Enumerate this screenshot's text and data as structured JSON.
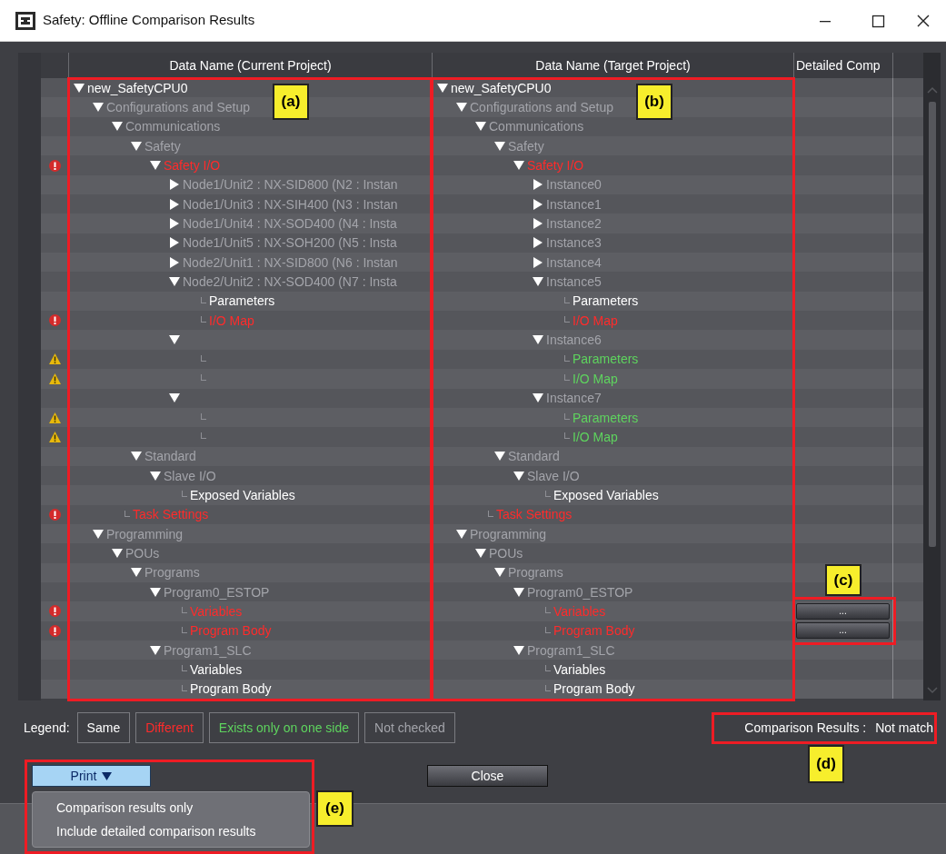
{
  "window": {
    "title": "Safety: Offline Comparison Results"
  },
  "table": {
    "columns": [
      "Data Name (Current Project)",
      "Data Name (Target Project)",
      "Detailed Comp"
    ],
    "current_tree": [
      {
        "label": "new_SafetyCPU0",
        "kind": "branch",
        "expanded": true,
        "color": "#ffffff",
        "children": [
          {
            "label": "Configurations and Setup",
            "kind": "branch",
            "expanded": true,
            "color": "#a3a4aa",
            "children": [
              {
                "label": "Communications",
                "kind": "branch",
                "expanded": true,
                "color": "#a3a4aa",
                "children": [
                  {
                    "label": "Safety",
                    "kind": "branch",
                    "expanded": true,
                    "color": "#a3a4aa",
                    "children": [
                      {
                        "label": "Safety I/O",
                        "kind": "branch",
                        "expanded": true,
                        "color": "#ff2b2b",
                        "error": true,
                        "children": [
                          {
                            "label": "Node1/Unit2 : NX-SID800 (N2 : Instan",
                            "kind": "branch",
                            "expanded": false,
                            "color": "#a3a4aa"
                          },
                          {
                            "label": "Node1/Unit3 : NX-SIH400 (N3 : Instan",
                            "kind": "branch",
                            "expanded": false,
                            "color": "#a3a4aa"
                          },
                          {
                            "label": "Node1/Unit4 : NX-SOD400 (N4 : Insta",
                            "kind": "branch",
                            "expanded": false,
                            "color": "#a3a4aa"
                          },
                          {
                            "label": "Node1/Unit5 : NX-SOH200 (N5 : Insta",
                            "kind": "branch",
                            "expanded": false,
                            "color": "#a3a4aa"
                          },
                          {
                            "label": "Node2/Unit1 : NX-SID800 (N6 : Instan",
                            "kind": "branch",
                            "expanded": false,
                            "color": "#a3a4aa"
                          },
                          {
                            "label": "Node2/Unit2 : NX-SOD400 (N7 : Insta",
                            "kind": "branch",
                            "expanded": true,
                            "color": "#a3a4aa",
                            "children": [
                              {
                                "label": "Parameters",
                                "kind": "leaf",
                                "color": "#ffffff"
                              },
                              {
                                "label": "I/O Map",
                                "kind": "leaf",
                                "color": "#ff2b2b",
                                "error": true
                              }
                            ]
                          },
                          {
                            "kind": "branch",
                            "expanded": true,
                            "children": [
                              {
                                "kind": "leaf",
                                "warning": true
                              },
                              {
                                "kind": "leaf",
                                "warning": true
                              }
                            ]
                          },
                          {
                            "kind": "branch",
                            "expanded": true,
                            "children": [
                              {
                                "kind": "leaf",
                                "warning": true
                              },
                              {
                                "kind": "leaf",
                                "warning": true
                              }
                            ]
                          }
                        ]
                      }
                    ]
                  },
                  {
                    "label": "Standard",
                    "kind": "branch",
                    "expanded": true,
                    "color": "#a3a4aa",
                    "children": [
                      {
                        "label": "Slave I/O",
                        "kind": "branch",
                        "expanded": true,
                        "color": "#a3a4aa",
                        "children": [
                          {
                            "label": "Exposed Variables",
                            "kind": "leaf",
                            "color": "#ffffff"
                          }
                        ]
                      }
                    ]
                  }
                ]
              },
              {
                "label": "Task Settings",
                "kind": "leaf",
                "color": "#ff2b2b",
                "error": true
              }
            ]
          },
          {
            "label": "Programming",
            "kind": "branch",
            "expanded": true,
            "color": "#a3a4aa",
            "children": [
              {
                "label": "POUs",
                "kind": "branch",
                "expanded": true,
                "color": "#a3a4aa",
                "children": [
                  {
                    "label": "Programs",
                    "kind": "branch",
                    "expanded": true,
                    "color": "#a3a4aa",
                    "children": [
                      {
                        "label": "Program0_ESTOP",
                        "kind": "branch",
                        "expanded": true,
                        "color": "#a3a4aa",
                        "children": [
                          {
                            "label": "Variables",
                            "kind": "leaf",
                            "color": "#ff2b2b",
                            "error": true
                          },
                          {
                            "label": "Program Body",
                            "kind": "leaf",
                            "color": "#ff2b2b",
                            "error": true
                          }
                        ]
                      },
                      {
                        "label": "Program1_SLC",
                        "kind": "branch",
                        "expanded": true,
                        "color": "#a3a4aa",
                        "children": [
                          {
                            "label": "Variables",
                            "kind": "leaf",
                            "color": "#ffffff"
                          },
                          {
                            "label": "Program Body",
                            "kind": "leaf",
                            "color": "#ffffff"
                          }
                        ]
                      }
                    ]
                  }
                ]
              }
            ]
          }
        ]
      }
    ],
    "target_tree": [
      {
        "label": "new_SafetyCPU0",
        "kind": "branch",
        "expanded": true,
        "color": "#ffffff",
        "children": [
          {
            "label": "Configurations and Setup",
            "kind": "branch",
            "expanded": true,
            "color": "#a3a4aa",
            "children": [
              {
                "label": "Communications",
                "kind": "branch",
                "expanded": true,
                "color": "#a3a4aa",
                "children": [
                  {
                    "label": "Safety",
                    "kind": "branch",
                    "expanded": true,
                    "color": "#a3a4aa",
                    "children": [
                      {
                        "label": "Safety I/O",
                        "kind": "branch",
                        "expanded": true,
                        "color": "#ff2b2b",
                        "children": [
                          {
                            "label": "Instance0",
                            "kind": "branch",
                            "expanded": false,
                            "color": "#a3a4aa"
                          },
                          {
                            "label": "Instance1",
                            "kind": "branch",
                            "expanded": false,
                            "color": "#a3a4aa"
                          },
                          {
                            "label": "Instance2",
                            "kind": "branch",
                            "expanded": false,
                            "color": "#a3a4aa"
                          },
                          {
                            "label": "Instance3",
                            "kind": "branch",
                            "expanded": false,
                            "color": "#a3a4aa"
                          },
                          {
                            "label": "Instance4",
                            "kind": "branch",
                            "expanded": false,
                            "color": "#a3a4aa"
                          },
                          {
                            "label": "Instance5",
                            "kind": "branch",
                            "expanded": true,
                            "color": "#a3a4aa",
                            "children": [
                              {
                                "label": "Parameters",
                                "kind": "leaf",
                                "color": "#ffffff"
                              },
                              {
                                "label": "I/O Map",
                                "kind": "leaf",
                                "color": "#ff2b2b"
                              }
                            ]
                          },
                          {
                            "label": "Instance6",
                            "kind": "branch",
                            "expanded": true,
                            "color": "#a3a4aa",
                            "children": [
                              {
                                "label": "Parameters",
                                "kind": "leaf",
                                "color": "#5ed45e"
                              },
                              {
                                "label": "I/O Map",
                                "kind": "leaf",
                                "color": "#5ed45e"
                              }
                            ]
                          },
                          {
                            "label": "Instance7",
                            "kind": "branch",
                            "expanded": true,
                            "color": "#a3a4aa",
                            "children": [
                              {
                                "label": "Parameters",
                                "kind": "leaf",
                                "color": "#5ed45e"
                              },
                              {
                                "label": "I/O Map",
                                "kind": "leaf",
                                "color": "#5ed45e"
                              }
                            ]
                          }
                        ]
                      }
                    ]
                  },
                  {
                    "label": "Standard",
                    "kind": "branch",
                    "expanded": true,
                    "color": "#a3a4aa",
                    "children": [
                      {
                        "label": "Slave I/O",
                        "kind": "branch",
                        "expanded": true,
                        "color": "#a3a4aa",
                        "children": [
                          {
                            "label": "Exposed Variables",
                            "kind": "leaf",
                            "color": "#ffffff"
                          }
                        ]
                      }
                    ]
                  }
                ]
              },
              {
                "label": "Task Settings",
                "kind": "leaf",
                "color": "#ff2b2b"
              }
            ]
          },
          {
            "label": "Programming",
            "kind": "branch",
            "expanded": true,
            "color": "#a3a4aa",
            "children": [
              {
                "label": "POUs",
                "kind": "branch",
                "expanded": true,
                "color": "#a3a4aa",
                "children": [
                  {
                    "label": "Programs",
                    "kind": "branch",
                    "expanded": true,
                    "color": "#a3a4aa",
                    "children": [
                      {
                        "label": "Program0_ESTOP",
                        "kind": "branch",
                        "expanded": true,
                        "color": "#a3a4aa",
                        "children": [
                          {
                            "label": "Variables",
                            "kind": "leaf",
                            "color": "#ff2b2b",
                            "detail": "..."
                          },
                          {
                            "label": "Program Body",
                            "kind": "leaf",
                            "color": "#ff2b2b",
                            "detail": "..."
                          }
                        ]
                      },
                      {
                        "label": "Program1_SLC",
                        "kind": "branch",
                        "expanded": true,
                        "color": "#a3a4aa",
                        "children": [
                          {
                            "label": "Variables",
                            "kind": "leaf",
                            "color": "#ffffff"
                          },
                          {
                            "label": "Program Body",
                            "kind": "leaf",
                            "color": "#ffffff"
                          }
                        ]
                      }
                    ]
                  }
                ]
              }
            ]
          }
        ]
      }
    ]
  },
  "legend": {
    "label": "Legend:",
    "items": [
      {
        "label": "Same",
        "color": "#ffffff"
      },
      {
        "label": "Different",
        "color": "#ff2b2b"
      },
      {
        "label": "Exists only on one side",
        "color": "#5ed45e"
      },
      {
        "label": "Not checked",
        "color": "#a3a4aa"
      }
    ]
  },
  "comparison_results": {
    "label": "Comparison Results :",
    "value": "Not match"
  },
  "print_button": {
    "label": "Print",
    "expanded": true,
    "menu": [
      "Comparison results only",
      "Include detailed comparison results"
    ]
  },
  "close_button": {
    "label": "Close"
  },
  "annotations": [
    {
      "label": "(a)"
    },
    {
      "label": "(b)"
    },
    {
      "label": "(c)"
    },
    {
      "label": "(d)"
    },
    {
      "label": "(e)"
    }
  ]
}
